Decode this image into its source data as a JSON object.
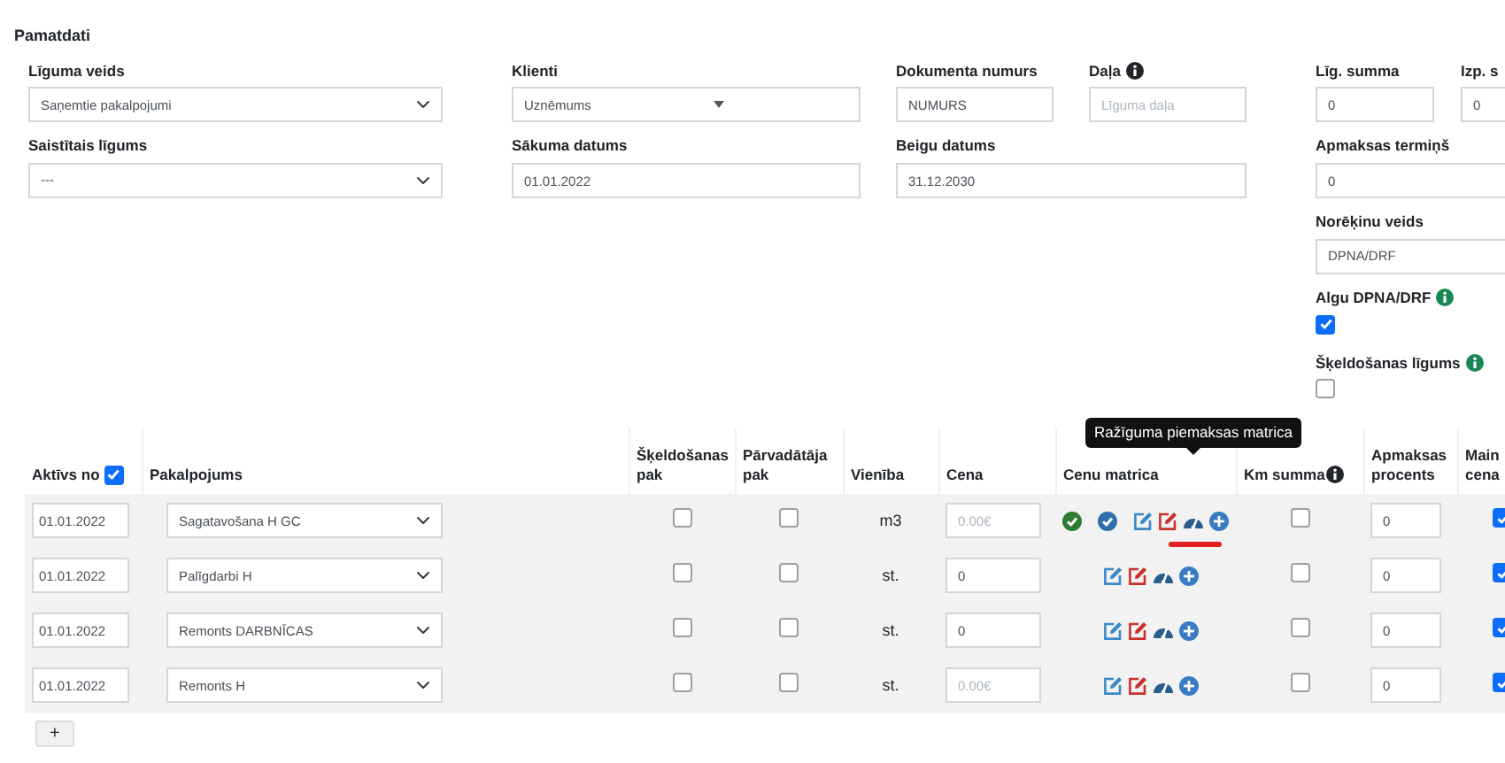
{
  "section_title": "Pamatdati",
  "fields": [
    {
      "label": "Līguma veids",
      "kind": "select",
      "value": "Saņemtie pakalpojumi"
    },
    {
      "label": "Klienti",
      "kind": "combo",
      "value": "Uznēmums"
    },
    {
      "label": "Dokumenta numurs",
      "kind": "text",
      "value": "NUMURS"
    },
    {
      "label": "Daļa",
      "kind": "text",
      "placeholder": "Līguma daļa",
      "info": {
        "color": "#212529"
      }
    },
    {
      "label": "Līg. summa",
      "kind": "text",
      "value": "0"
    },
    {
      "label": "Izp. s",
      "kind": "text",
      "value": "0"
    },
    {
      "label": "Saistītais līgums",
      "kind": "select",
      "value": "---"
    },
    {
      "label": "Sākuma datums",
      "kind": "text",
      "value": "01.01.2022"
    },
    {
      "label": "Beigu datums",
      "kind": "text",
      "value": "31.12.2030"
    },
    {
      "label": "Apmaksas termiņš",
      "kind": "text",
      "value": "0"
    },
    {
      "label": "Norēķinu veids",
      "kind": "text",
      "value": "DPNA/DRF"
    },
    {
      "label": "Algu DPNA/DRF",
      "kind": "checkbox",
      "checked": true,
      "info": {
        "color": "#198754"
      }
    },
    {
      "label": "Šķeldošanas līgums",
      "kind": "checkbox",
      "checked": false,
      "info": {
        "color": "#198754"
      }
    }
  ],
  "table": {
    "columns": [
      {
        "label": "Aktīvs no",
        "checked": true
      },
      {
        "label": "Pakalpojums"
      },
      {
        "label": "Šķeldošanas pak"
      },
      {
        "label": "Pārvadātāja pak"
      },
      {
        "label": "Vienība"
      },
      {
        "label": "Cena"
      },
      {
        "label": "Cenu matrica"
      },
      {
        "label": "Km summa",
        "info": {
          "color": "#212529"
        }
      },
      {
        "label": "Apmaksas procents"
      },
      {
        "label": "Main cena"
      }
    ],
    "rows": [
      {
        "active_from": "01.01.2022",
        "service": "Sagatavošana H GC",
        "chipping": false,
        "carrier": false,
        "unit": "m3",
        "price": {
          "placeholder": "0.00€"
        },
        "approved": true,
        "confirmed": true,
        "km": false,
        "payment_percent": "0",
        "change_price": true,
        "tooltip": {
          "text": "Ražīguma piemaksas matrica",
          "underlined": true
        }
      },
      {
        "active_from": "01.01.2022",
        "service": "Palīgdarbi H",
        "chipping": false,
        "carrier": false,
        "unit": "st.",
        "price": {
          "value": "0"
        },
        "approved": false,
        "confirmed": false,
        "km": false,
        "payment_percent": "0",
        "change_price": true
      },
      {
        "active_from": "01.01.2022",
        "service": "Remonts DARBNĪCAS",
        "chipping": false,
        "carrier": false,
        "unit": "st.",
        "price": {
          "value": "0"
        },
        "approved": false,
        "confirmed": false,
        "km": false,
        "payment_percent": "0",
        "change_price": true
      },
      {
        "active_from": "01.01.2022",
        "service": "Remonts H",
        "chipping": false,
        "carrier": false,
        "unit": "st.",
        "price": {
          "placeholder": "0.00€"
        },
        "approved": false,
        "confirmed": false,
        "km": false,
        "payment_percent": "0",
        "change_price": true
      }
    ],
    "add_button": "+"
  }
}
